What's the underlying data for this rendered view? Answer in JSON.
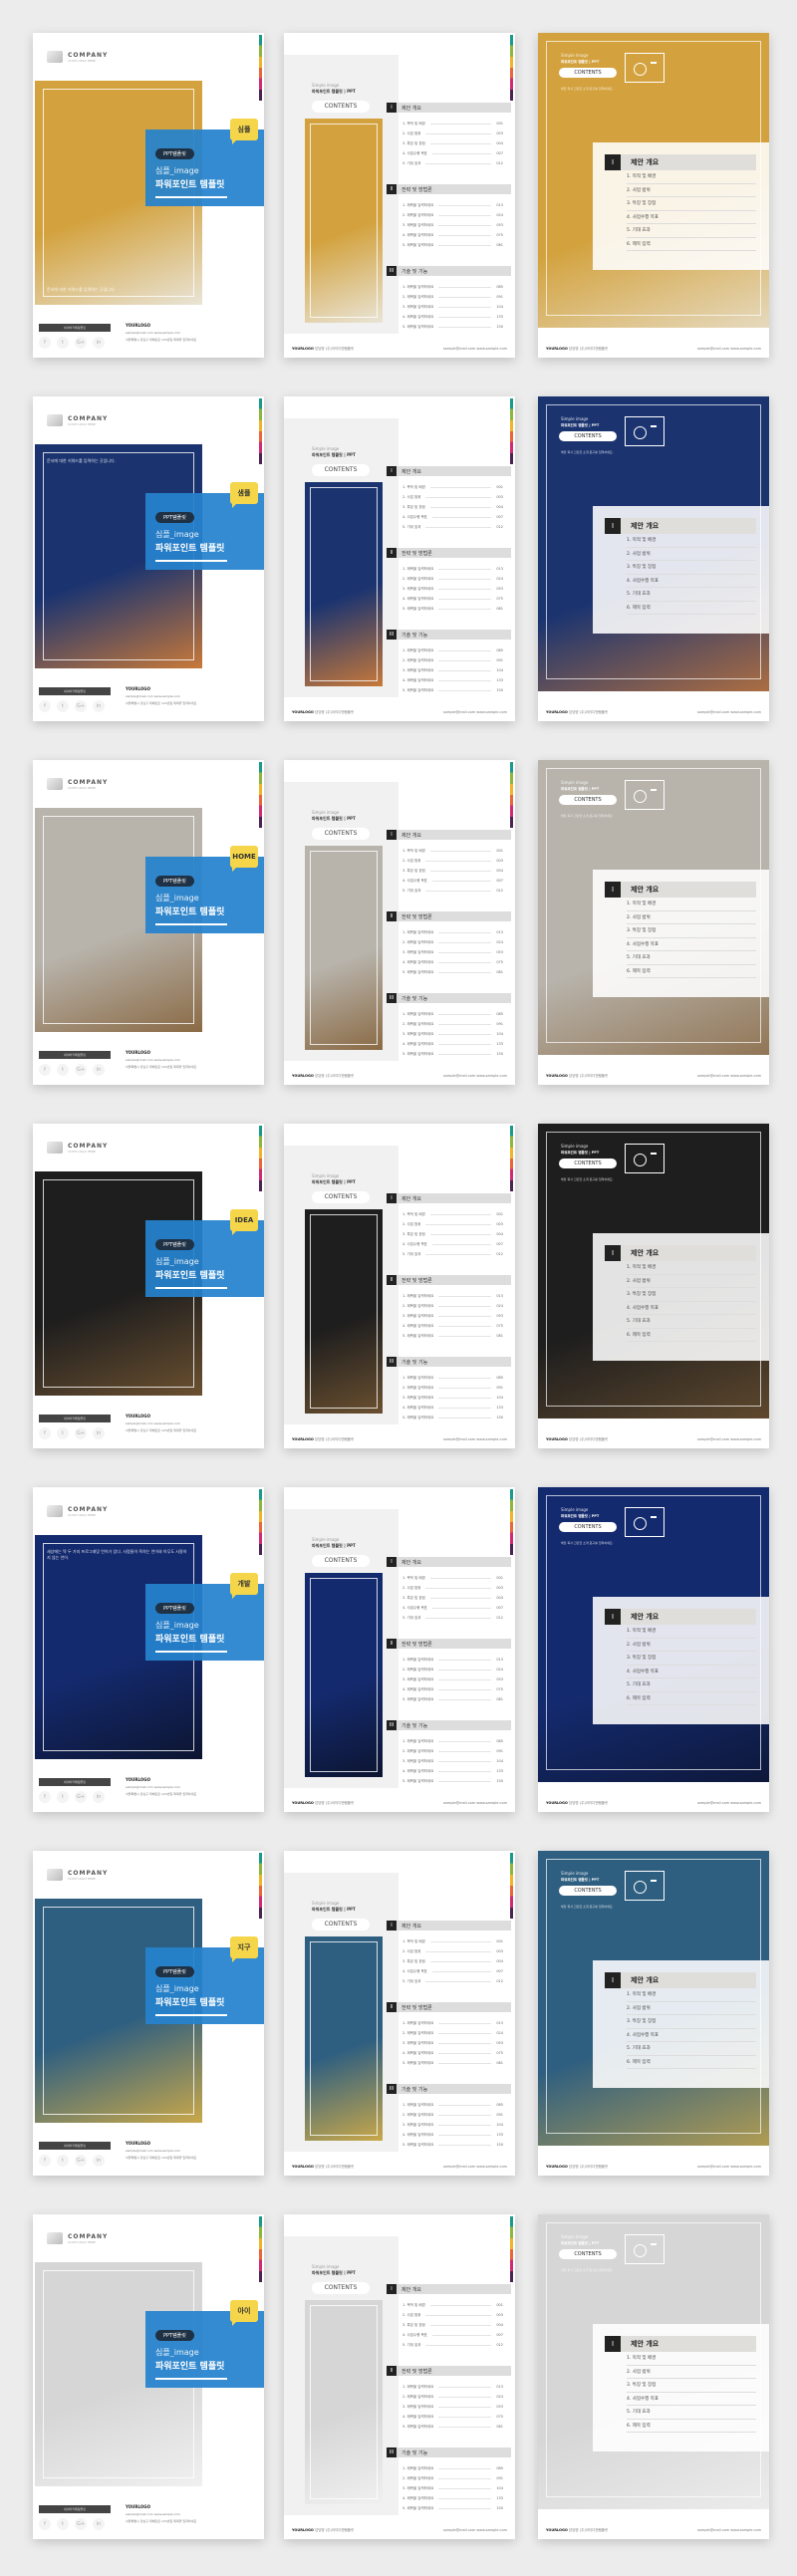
{
  "common": {
    "company": "COMPANY",
    "company_sub": "CLYNT LOGO HERE",
    "pill": "PPT템플릿",
    "title1": "심플_image",
    "title2": "파워포인트 템플릿",
    "footer_bar": "네이버카페템플릿",
    "social": [
      "f",
      "t",
      "G+",
      "in"
    ],
    "your_logo": "YOURLOGO",
    "email": "sample@mail.com",
    "web": "www.sample.com",
    "address": "서울특별시 강남구 테헤란로 123번길 제목을 입력하세요",
    "simple": "Simple image",
    "simple2": "파워포인트 템플릿 | PPT",
    "contents": "CONTENTS",
    "footer_company": "담당명 (주)아이디엔템플릿",
    "cover3_sub": "해당 회사 간단한 소개 문구를 입력하세요.",
    "sections": [
      {
        "num": "I",
        "title": "제안 개요",
        "items": [
          [
            "1. 목적 및 배경",
            "001"
          ],
          [
            "2. 사업 범위",
            "003"
          ],
          [
            "3. 특징 및 장점",
            "004"
          ],
          [
            "4. 사업수행 목표",
            "007"
          ],
          [
            "5. 기대 효과",
            "012"
          ]
        ]
      },
      {
        "num": "II",
        "title": "전략 및 방법론",
        "items": [
          [
            "1. 제목을 입력하세요",
            "013"
          ],
          [
            "2. 제목을 입력하세요",
            "024"
          ],
          [
            "3. 제목을 입력하세요",
            "053"
          ],
          [
            "4. 제목을 입력하세요",
            "075"
          ],
          [
            "5. 제목을 입력하세요",
            "081"
          ]
        ]
      },
      {
        "num": "III",
        "title": "기술 및 기능",
        "items": [
          [
            "1. 제목을 입력하세요",
            "085"
          ],
          [
            "2. 제목을 입력하세요",
            "091"
          ],
          [
            "3. 제목을 입력하세요",
            "104"
          ],
          [
            "4. 제목을 입력하세요",
            "133"
          ],
          [
            "5. 제목을 입력하세요",
            "150"
          ]
        ]
      }
    ],
    "panel": {
      "num": "I",
      "title": "제안 개요",
      "items": [
        "1. 목적 및 배경",
        "2. 사업 범위",
        "3. 특징 및 장점",
        "4. 사업수행 목표",
        "5. 기대 효과",
        "6. 제목 입력"
      ]
    }
  },
  "rows": [
    {
      "badge": "심플",
      "caption": "문서에 대한 키워드를 입력하는 곳입니다.",
      "caption_top": false,
      "photo": "#d3a23e",
      "photo2": "#e9e4d6"
    },
    {
      "badge": "샘플",
      "caption": "문서에 대한 키워드를 입력하는 곳입니다.",
      "caption_top": true,
      "photo": "#1b3470",
      "photo2": "#c8793a"
    },
    {
      "badge": "HOME",
      "caption": "",
      "caption_top": true,
      "photo": "#b8b4ac",
      "photo2": "#8a6a45"
    },
    {
      "badge": "IDEA",
      "caption": "",
      "caption_top": true,
      "photo": "#1e1e1e",
      "photo2": "#6b5030"
    },
    {
      "badge": "개발",
      "caption": "세상에는 딱 두 가지 프로그래밍 언어가 있다. 사람들이 욕하는 언어와 아무도 사용하지 않는 언어.",
      "caption_top": true,
      "photo": "#142a6e",
      "photo2": "#0c1430"
    },
    {
      "badge": "지구",
      "caption": "",
      "caption_top": true,
      "photo": "#2f5f80",
      "photo2": "#c9a84a"
    },
    {
      "badge": "아이",
      "caption": "",
      "caption_top": false,
      "photo": "#d6d6d6",
      "photo2": "#f0f0f0"
    }
  ],
  "colors": {
    "blue": "#2682cd",
    "badge": "#f5d64a",
    "dark": "#1f3144"
  }
}
